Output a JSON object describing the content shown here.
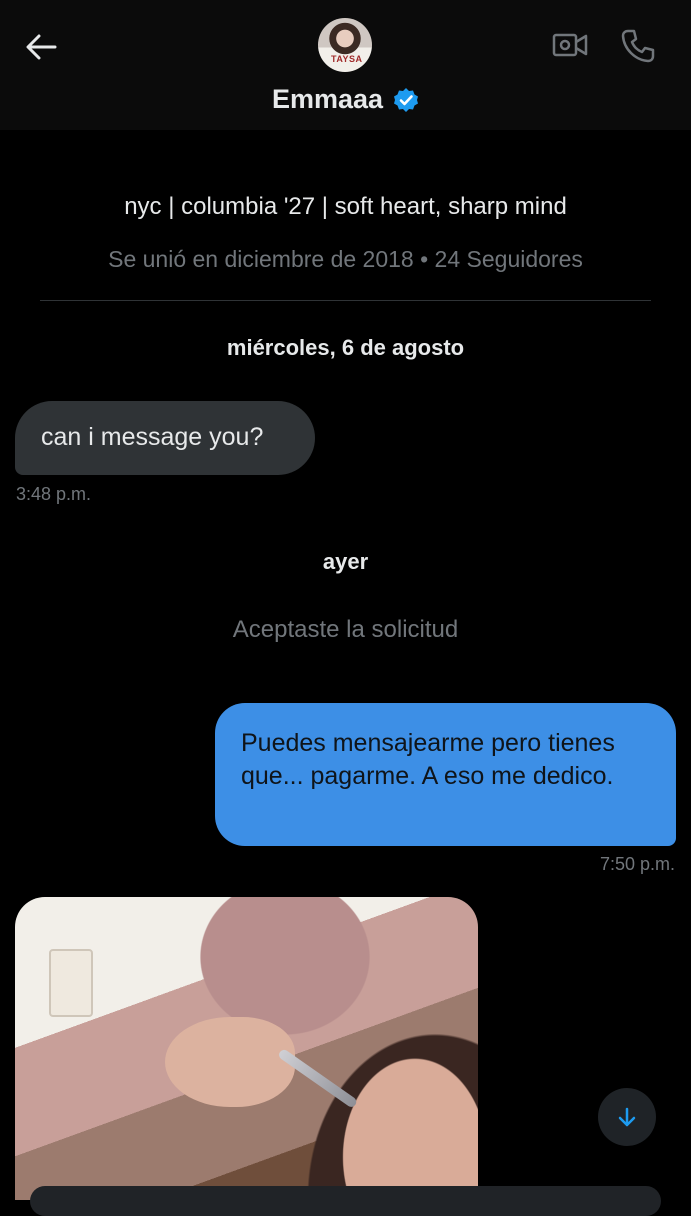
{
  "header": {
    "name": "Emmaaa",
    "back_icon": "arrow-left-icon",
    "video_icon": "video-call-icon",
    "phone_icon": "phone-icon",
    "verified_icon": "verified-badge-icon",
    "avatar_shirt_text": "TAYSA"
  },
  "profile": {
    "bio": "nyc | columbia '27 | soft heart, sharp mind",
    "meta": "Se unió en diciembre de 2018 • 24 Seguidores"
  },
  "conversation": {
    "date1": "miércoles, 6 de agosto",
    "message1": {
      "text": "can i message you?",
      "time": "3:48 p.m."
    },
    "date2": "ayer",
    "system_message": "Aceptaste la solicitud",
    "message2": {
      "text": "Puedes mensajearme pero tienes que... pagarme. A eso me dedico.",
      "time": "7:50 p.m."
    }
  },
  "colors": {
    "background": "#000000",
    "header_bg": "#0b0b0b",
    "incoming_bubble": "#2f3336",
    "outgoing_bubble": "#3d8fe6",
    "verified": "#1d9bf0",
    "muted_text": "#71767b"
  },
  "scroll_icon": "arrow-down-icon"
}
